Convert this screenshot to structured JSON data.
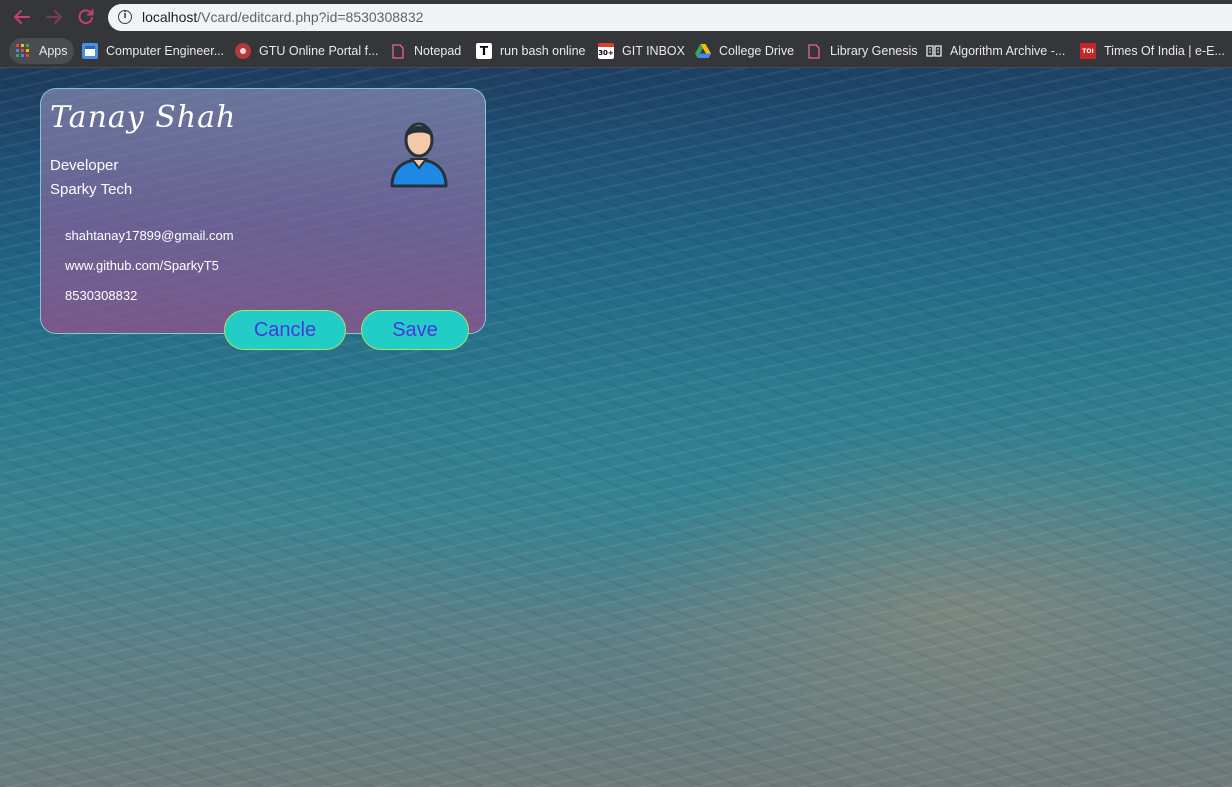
{
  "browser": {
    "url_host": "localhost",
    "url_path": "/Vcard/editcard.php?id=8530308832",
    "bookmarks": [
      {
        "label": "Apps",
        "icon": "apps-grid-icon"
      },
      {
        "label": "Computer Engineer...",
        "icon": "blogger-doc-icon"
      },
      {
        "label": "GTU Online Portal f...",
        "icon": "gtu-logo-icon"
      },
      {
        "label": "Notepad",
        "icon": "page-icon"
      },
      {
        "label": "run bash online",
        "icon": "t-logo-icon"
      },
      {
        "label": "GIT INBOX",
        "icon": "git-inbox-icon"
      },
      {
        "label": "College Drive",
        "icon": "google-drive-icon"
      },
      {
        "label": "Library Genesis",
        "icon": "page-icon"
      },
      {
        "label": "Algorithm Archive -...",
        "icon": "book-icon"
      },
      {
        "label": "Times Of India | e-E...",
        "icon": "toi-logo-icon"
      }
    ]
  },
  "card": {
    "name": "Tanay Shah",
    "role": "Developer",
    "company": "Sparky Tech",
    "email": "shahtanay17899@gmail.com",
    "website": "www.github.com/SparkyT5",
    "phone": "8530308832",
    "cancel_label": "Cancle",
    "save_label": "Save"
  },
  "colors": {
    "button_bg": "#22cdc8",
    "button_text": "#4a37d9",
    "button_border": "#a8e65a",
    "card_border": "#8cdce6"
  }
}
